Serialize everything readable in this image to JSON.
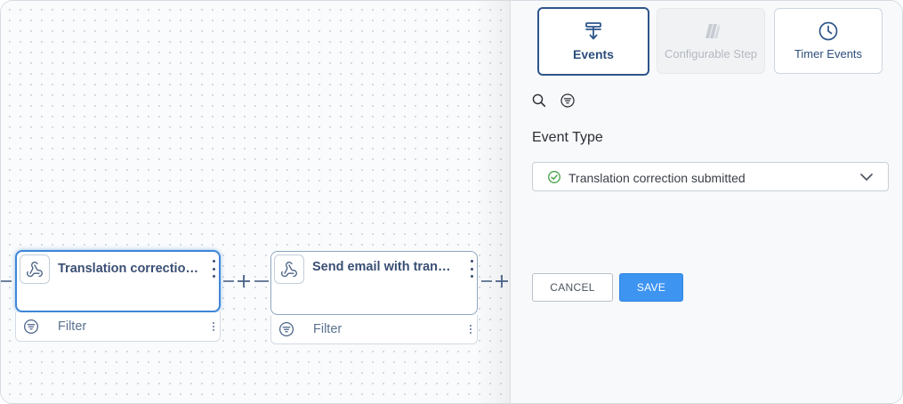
{
  "canvas": {
    "nodes": [
      {
        "title": "Translation correction submitted",
        "filter_label": "Filter",
        "selected": true
      },
      {
        "title": "Send email with translation correction",
        "filter_label": "Filter",
        "selected": false
      }
    ]
  },
  "panel": {
    "tabs": [
      {
        "label": "Events",
        "icon": "events-icon",
        "state": "active"
      },
      {
        "label": "Configurable Step",
        "icon": "configurable-step-icon",
        "state": "disabled"
      },
      {
        "label": "Timer Events",
        "icon": "clock-icon",
        "state": "default"
      }
    ],
    "tools": {
      "search": "search-icon",
      "filter": "filter-icon"
    },
    "event_type": {
      "label": "Event Type",
      "value": "Translation correction submitted"
    },
    "buttons": {
      "cancel": "CANCEL",
      "save": "SAVE"
    }
  },
  "colors": {
    "accent": "#3d94f1",
    "active_tab_border": "#2e558b",
    "node_selected_border": "#3e86d8",
    "node_title": "#3a4f74",
    "check_green": "#43a047"
  }
}
